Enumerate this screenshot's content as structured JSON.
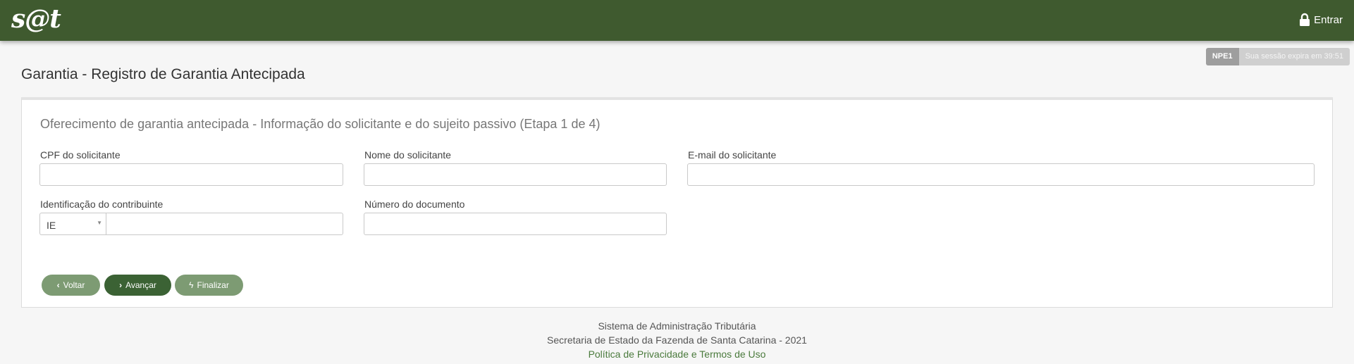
{
  "header": {
    "logo": "s@t",
    "login_label": "Entrar",
    "login_icon": "lock-icon"
  },
  "session": {
    "code": "NPE1",
    "expire_text": "Sua sessão expira em 39:51"
  },
  "page_title": "Garantia - Registro de Garantia Antecipada",
  "panel": {
    "title": "Oferecimento de garantia antecipada - Informação do solicitante e do sujeito passivo (Etapa 1 de 4)",
    "fields": {
      "cpf_label": "CPF do solicitante",
      "nome_label": "Nome do solicitante",
      "email_label": "E-mail do solicitante",
      "identificacao_label": "Identificação do contribuinte",
      "identificacao_type": "IE",
      "numero_label": "Número do documento"
    },
    "buttons": {
      "voltar": "Voltar",
      "avancar": "Avançar",
      "finalizar": "Finalizar"
    }
  },
  "footer": {
    "line1": "Sistema de Administração Tributária",
    "line2": "Secretaria de Estado da Fazenda de Santa Catarina - 2021",
    "link": "Política de Privacidade e Termos de Uso"
  }
}
